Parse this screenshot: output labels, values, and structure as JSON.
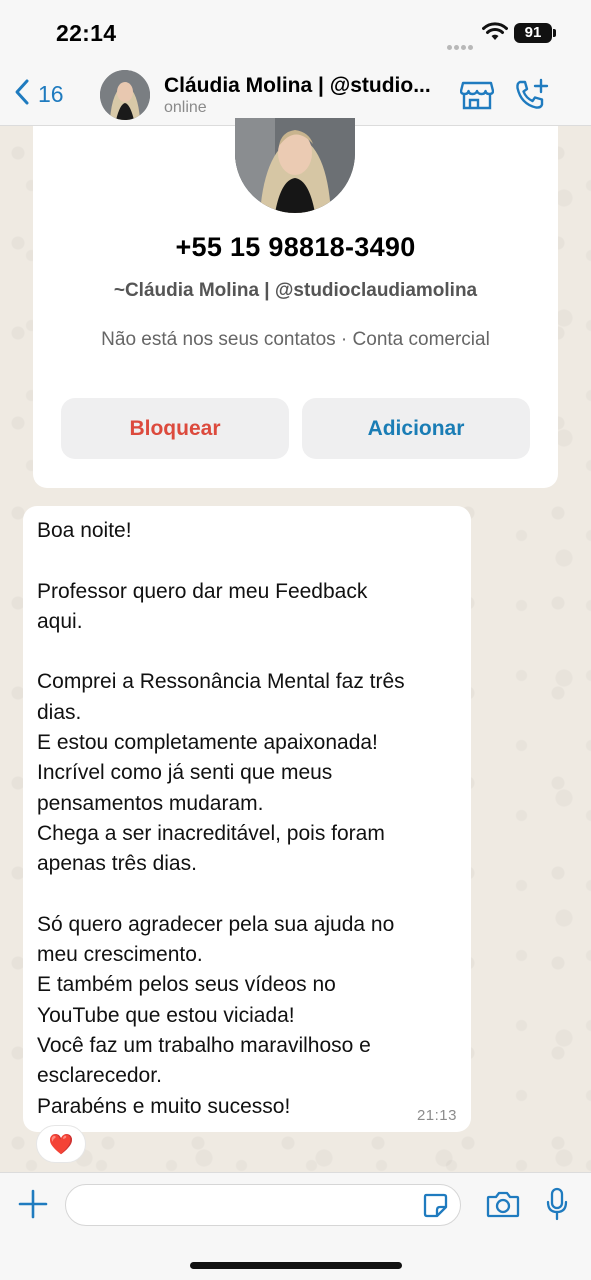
{
  "status_bar": {
    "time": "22:14",
    "battery": "91"
  },
  "header": {
    "back_count": "16",
    "contact_name": "Cláudia Molina | @studio...",
    "status": "online",
    "back_icon": "chevron-left-icon",
    "store_icon": "storefront-icon",
    "call_icon": "phone-add-icon"
  },
  "contact_card": {
    "phone": "+55 15 98818-3490",
    "handle": "~Cláudia Molina | @studioclaudiamolina",
    "info": "Não está nos seus contatos · Conta comercial",
    "block_label": "Bloquear",
    "add_label": "Adicionar"
  },
  "message": {
    "text": "Boa noite!\n\nProfessor quero dar meu Feedback\naqui.\n\nComprei a Ressonância Mental faz três\ndias.\nE estou completamente apaixonada!\nIncrível como já senti que meus\npensamentos mudaram.\nChega a ser inacreditável, pois foram\napenas três dias.\n\nSó quero agradecer pela sua ajuda no\nmeu crescimento.\nE também pelos seus vídeos no\nYouTube que estou viciada!\nVocê faz um trabalho maravilhoso e\nesclarecedor.\nParabéns e muito sucesso!",
    "time": "21:13",
    "reaction": "❤️"
  },
  "input_bar": {
    "placeholder": ""
  },
  "colors": {
    "accent": "#1f7bbf",
    "block": "#dc4a3d",
    "add": "#1a7db5",
    "chat_bg": "#efeae2"
  }
}
